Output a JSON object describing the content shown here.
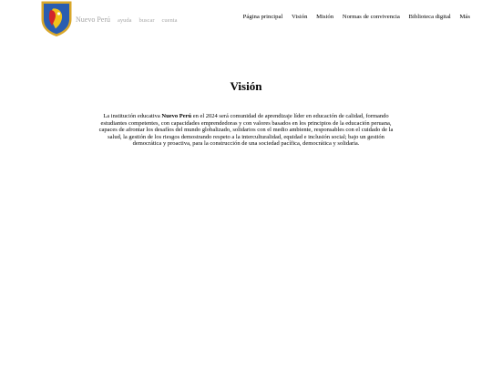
{
  "site": {
    "name": "Nuevo Perú",
    "links": [
      "ayuda",
      "buscar",
      "cuenta"
    ]
  },
  "nav": {
    "items": [
      "Página principal",
      "Visión",
      "Misión",
      "Normas de convivencia",
      "Biblioteca digital",
      "Más"
    ]
  },
  "main": {
    "title": "Visión",
    "paragraph": {
      "before": "La institución educativa ",
      "bold": "Nuevo Perú",
      "after": " en el 2024 será comunidad de aprendizaje líder en educación de calidad, formando estudiantes competentes, con capacidades emprendedoras y con valores basados en los principios de la educación peruana, capaces de afrontar los desafíos del mundo globalizado, solidarios con el medio ambiente, responsables con el cuidado de la salud, la gestión de los riesgos demostrando respeto a la interculturalidad, equidad e inclusión social; bajo un gestión democrática y proactiva, para la construcción de una sociedad pacífica, democrática y solidaria."
    }
  },
  "theme": {
    "shield_gold": "#d9a72a",
    "shield_blue": "#2a5db0",
    "emblem_red": "#d3262a",
    "emblem_yellow": "#f1c21b",
    "emblem_white": "#ffffff"
  }
}
